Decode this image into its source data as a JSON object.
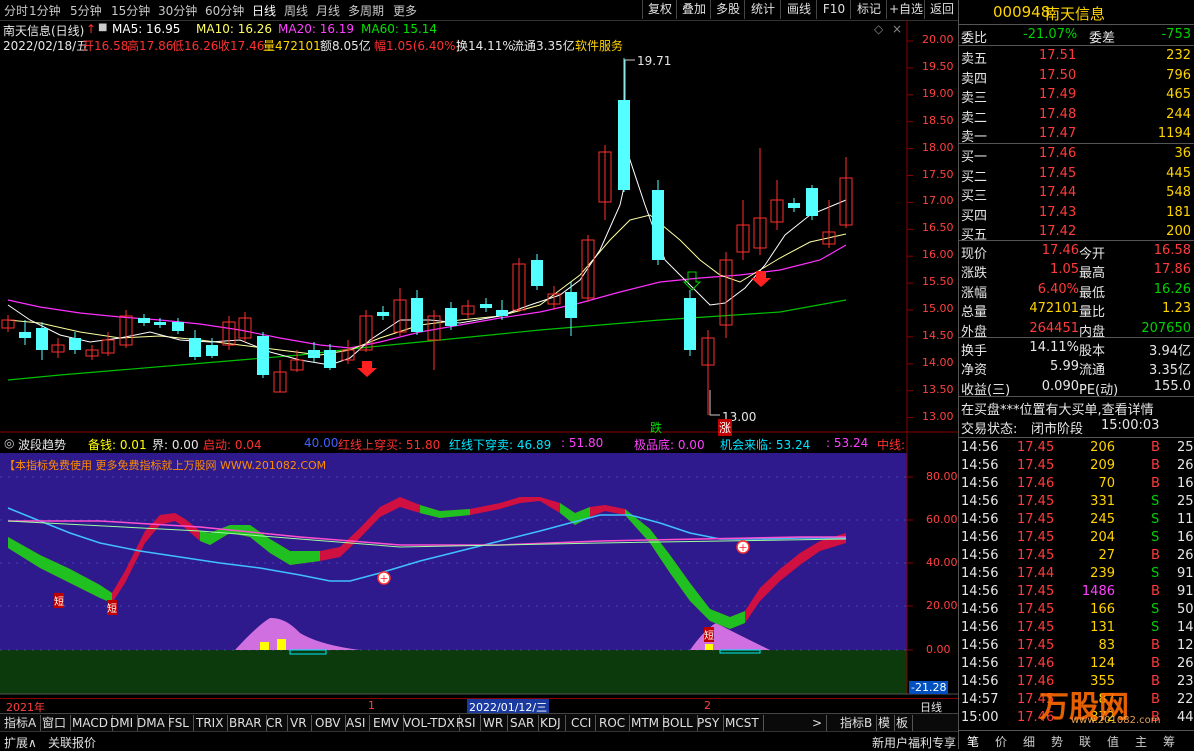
{
  "top_tabs": [
    "分时",
    "1分钟",
    "5分钟",
    "15分钟",
    "30分钟",
    "60分钟",
    "日线",
    "周线",
    "月线",
    "多周期",
    "更多"
  ],
  "active_tab": "日线",
  "toolbar": [
    "复权",
    "叠加",
    "多股",
    "统计",
    "画线",
    "F10",
    "标记",
    "+自选",
    "返回"
  ],
  "main": {
    "title": "南天信息(日线)",
    "ma5": "MA5: 16.95",
    "ma10": "MA10: 16.26",
    "ma20": "MA20: 16.19",
    "ma60": "MA60: 15.14",
    "info_date": "2022/02/18/五",
    "info_open": "开16.58",
    "info_high": "高17.86",
    "info_low": "低16.26",
    "info_close": "收17.46",
    "info_vol": "量472101",
    "info_amt": "额8.05亿",
    "info_range": "幅1.05(6.40%)",
    "info_turn": "换14.11%",
    "info_float": "流通3.35亿",
    "info_sector": "软件服务",
    "price_axis": [
      "20.00",
      "19.50",
      "19.00",
      "18.50",
      "18.00",
      "17.50",
      "17.00",
      "16.50",
      "16.00",
      "15.50",
      "15.00",
      "14.50",
      "14.00",
      "13.50",
      "13.00"
    ],
    "high_label": "19.71",
    "low_label": "13.00",
    "tag_fall": "跌",
    "tag_rise": "涨"
  },
  "indicator": {
    "name": "波段趋势",
    "p1": "备钱: 0.01",
    "p2": "界: 0.00",
    "p3": "启动: 0.04",
    "p4": "40.00",
    "p5": "红线上穿买: 51.80",
    "p6": "红线下穿卖: 46.89",
    "p7": ": 51.80",
    "p8": "极品底: 0.00",
    "p9": "机会来临: 53.24",
    "p10": ": 53.24",
    "p11": "中线:",
    "ad": "【本指标免费使用 更多免费指标就上万股网 WWW.201082.COM",
    "axis": [
      "80.00",
      "60.00",
      "40.00",
      "20.00",
      "0.00"
    ],
    "value_tag": "-21.28",
    "short1": "短",
    "short2": "短",
    "short3": "短"
  },
  "date_axis": {
    "year": "2021年",
    "m1": "1",
    "cursor": "2022/01/12/三",
    "m2": "2",
    "period": "日线"
  },
  "bottom_tabs": [
    "指标A",
    "窗口",
    "MACD",
    "DMI",
    "DMA",
    "FSL",
    "TRIX",
    "BRAR",
    "CR",
    "VR",
    "OBV",
    "ASI",
    "EMV",
    "VOL-TDX",
    "RSI",
    "WR",
    "SAR",
    "KDJ",
    "CCI",
    "ROC",
    "MTM",
    "BOLL",
    "PSY",
    "MCST"
  ],
  "bottom_right": [
    "指标B",
    "模",
    "板"
  ],
  "status_left": [
    "扩展∧",
    "关联报价"
  ],
  "status_right": "新用户福利专享",
  "quote": {
    "code": "000948",
    "name": "南天信息",
    "weibi_label": "委比",
    "weibi": "-21.07%",
    "weicha_label": "委差",
    "weicha": "-753",
    "asks": [
      [
        "卖五",
        "17.51",
        "232"
      ],
      [
        "卖四",
        "17.50",
        "796"
      ],
      [
        "卖三",
        "17.49",
        "465"
      ],
      [
        "卖二",
        "17.48",
        "244"
      ],
      [
        "卖一",
        "17.47",
        "1194"
      ]
    ],
    "bids": [
      [
        "买一",
        "17.46",
        "36"
      ],
      [
        "买二",
        "17.45",
        "445"
      ],
      [
        "买三",
        "17.44",
        "548"
      ],
      [
        "买四",
        "17.43",
        "181"
      ],
      [
        "买五",
        "17.42",
        "200"
      ]
    ],
    "stats": [
      [
        "现价",
        "17.46",
        "今开",
        "16.58"
      ],
      [
        "涨跌",
        "1.05",
        "最高",
        "17.86"
      ],
      [
        "涨幅",
        "6.40%",
        "最低",
        "16.26"
      ],
      [
        "总量",
        "472101",
        "量比",
        "1.23"
      ],
      [
        "外盘",
        "264451",
        "内盘",
        "207650"
      ]
    ],
    "stats2": [
      [
        "换手",
        "14.11%",
        "股本",
        "3.94亿"
      ],
      [
        "净资",
        "5.99",
        "流通",
        "3.35亿"
      ],
      [
        "收益(三)",
        "0.090",
        "PE(动)",
        "155.0"
      ]
    ],
    "notice": "在买盘***位置有大买单,查看详情",
    "trade_state_label": "交易状态:",
    "trade_state": "闭市阶段",
    "trade_time": "15:00:03",
    "ticks": [
      [
        "14:56",
        "17.45",
        "206",
        "B",
        "25"
      ],
      [
        "14:56",
        "17.45",
        "209",
        "B",
        "26"
      ],
      [
        "14:56",
        "17.46",
        "70",
        "B",
        "16"
      ],
      [
        "14:56",
        "17.45",
        "331",
        "S",
        "25"
      ],
      [
        "14:56",
        "17.45",
        "245",
        "S",
        "11"
      ],
      [
        "14:56",
        "17.45",
        "204",
        "S",
        "16"
      ],
      [
        "14:56",
        "17.45",
        "27",
        "B",
        "26"
      ],
      [
        "14:56",
        "17.44",
        "239",
        "S",
        "91"
      ],
      [
        "14:56",
        "17.45",
        "1486",
        "B",
        "91"
      ],
      [
        "14:56",
        "17.45",
        "166",
        "S",
        "50"
      ],
      [
        "14:56",
        "17.45",
        "131",
        "S",
        "14"
      ],
      [
        "14:56",
        "17.45",
        "83",
        "B",
        "12"
      ],
      [
        "14:56",
        "17.46",
        "124",
        "B",
        "26"
      ],
      [
        "14:56",
        "17.46",
        "355",
        "B",
        "23"
      ],
      [
        "14:57",
        "17.45",
        "87",
        "B",
        "22"
      ],
      [
        "15:00",
        "17.46",
        "872",
        "B",
        "44"
      ]
    ],
    "tabs": [
      "笔",
      "价",
      "细",
      "势",
      "联",
      "值",
      "主",
      "筹"
    ],
    "watermark": "万股网",
    "watermark_url": "www.201082.com"
  }
}
